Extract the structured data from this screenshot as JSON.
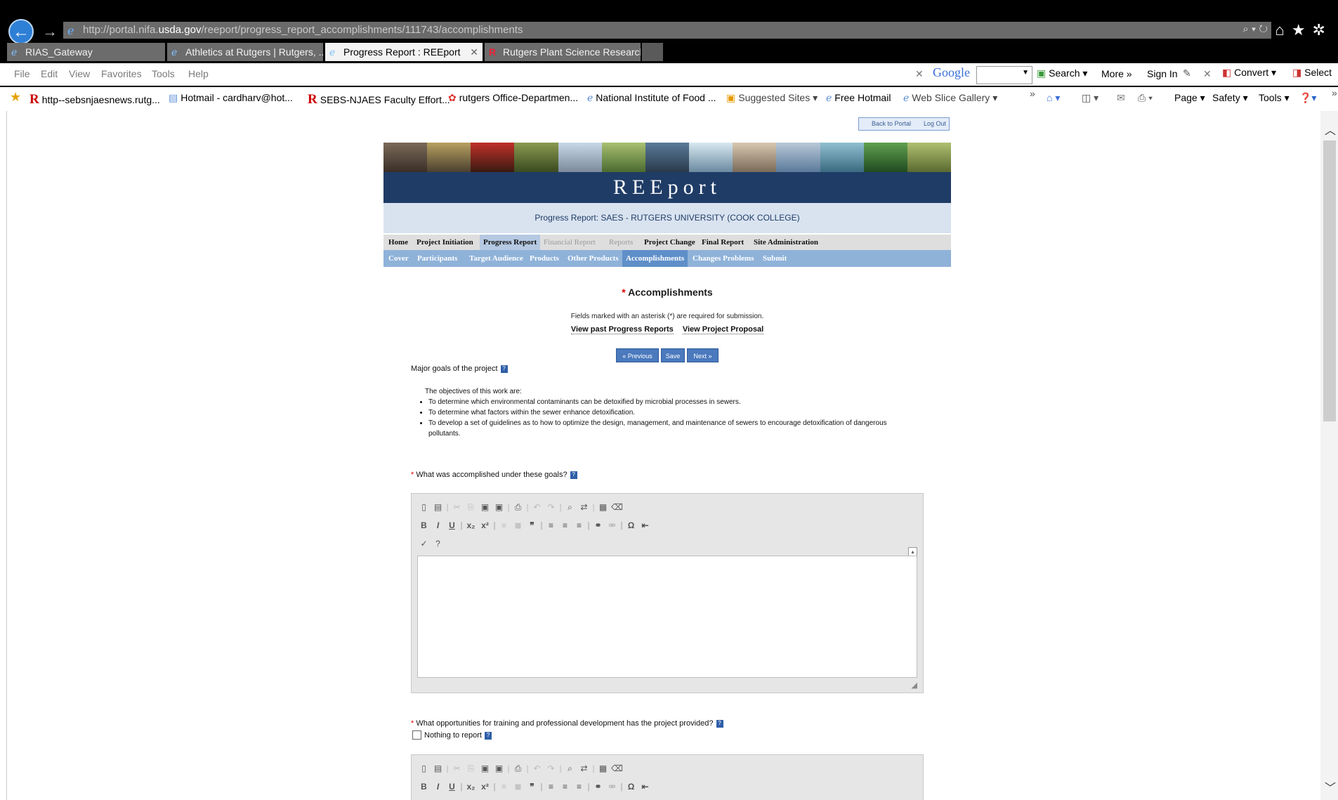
{
  "browser": {
    "url_prefix": "http://portal.nifa.",
    "url_domain": "usda.gov",
    "url_path": "/reeport/progress_report_accomplishments/111743/accomplishments",
    "url_tools": "⌕ ▾ ↻",
    "tabs": [
      {
        "label": "RIAS_Gateway"
      },
      {
        "label": "Athletics at Rutgers | Rutgers, ..."
      },
      {
        "label": "Progress Report : REEport"
      },
      {
        "label": "Rutgers Plant Science Research..."
      }
    ],
    "tab_close": "✕",
    "menu": [
      "File",
      "Edit",
      "View",
      "Favorites",
      "Tools",
      "Help"
    ],
    "google_bar": {
      "close": "✕",
      "logo": "Google",
      "search": "Search",
      "more": "More »",
      "sign_in": "Sign In",
      "close2": "✕",
      "convert": "Convert",
      "select": "Select"
    },
    "favorites": [
      "http--sebsnjaesnews.rutg...",
      "Hotmail - cardharv@hot...",
      "SEBS-NJAES Faculty Effort...",
      "rutgers Office-Departmen...",
      "National Institute of Food ...",
      "Suggested Sites ▾",
      "Free Hotmail",
      "Web Slice Gallery ▾"
    ],
    "commands": {
      "page": "Page ▾",
      "safety": "Safety ▾",
      "tools": "Tools ▾"
    }
  },
  "portal": {
    "back_to_portal": "Back to Portal",
    "log_out": "Log Out",
    "logo": "REEport",
    "title": "Progress Report: SAES - RUTGERS UNIVERSITY (COOK COLLEGE)",
    "nav_main": [
      {
        "label": "Home"
      },
      {
        "label": "Project Initiation"
      },
      {
        "label": "Progress Report"
      },
      {
        "label": "Financial Report"
      },
      {
        "label": "Reports"
      },
      {
        "label": "Project Change"
      },
      {
        "label": "Final Report"
      },
      {
        "label": "Site Administration"
      }
    ],
    "nav_sub": [
      {
        "label": "Cover"
      },
      {
        "label": "Participants"
      },
      {
        "label": "Target Audience"
      },
      {
        "label": "Products"
      },
      {
        "label": "Other Products"
      },
      {
        "label": "Accomplishments"
      },
      {
        "label": "Changes Problems"
      },
      {
        "label": "Submit"
      }
    ]
  },
  "form": {
    "required_mark": "*",
    "heading": "Accomplishments",
    "note": "Fields marked with an asterisk (*) are required for submission.",
    "link_past": "View past Progress Reports",
    "link_proposal": "View Project Proposal",
    "btn_previous": "« Previous",
    "btn_save": "Save",
    "btn_next": "Next »",
    "goals_label": "Major goals of the project",
    "goals_intro": "The objectives of this work are:",
    "goals": [
      "To determine which environmental contaminants can be detoxified by microbial processes in sewers.",
      "To determine what factors within the sewer enhance detoxification.",
      "To develop a set of guidelines as to how to optimize the design, management, and maintenance of sewers to encourage detoxification of dangerous pollutants."
    ],
    "q1": "What was accomplished under these goals?",
    "q2": "What opportunities for training and professional development has the project provided?",
    "nothing_to_report": "Nothing to report",
    "help_glyph": "?"
  }
}
